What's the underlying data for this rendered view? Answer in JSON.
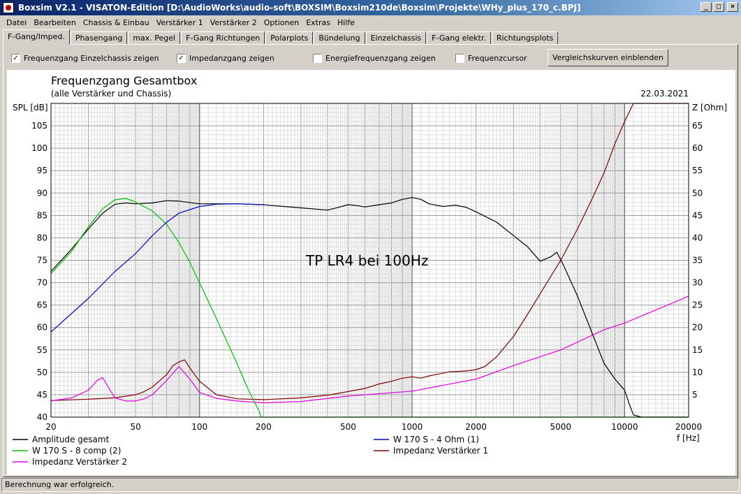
{
  "window": {
    "title": "Boxsim V2.1 - VISATON-Edition [D:\\AudioWorks\\audio-soft\\BOXSIM\\Boxsim210de\\Boxsim\\Projekte\\WHy_plus_170_c.BPJ]",
    "btn_min": "_",
    "btn_max": "□",
    "btn_close": "×"
  },
  "menu": [
    "Datei",
    "Bearbeiten",
    "Chassis & Einbau",
    "Verstärker 1",
    "Verstärker 2",
    "Optionen",
    "Extras",
    "Hilfe"
  ],
  "tabs": [
    "F-Gang/Imped.",
    "Phasengang",
    "max. Pegel",
    "F-Gang Richtungen",
    "Polarplots",
    "Bündelung",
    "Einzelchassis",
    "F-Gang elektr.",
    "Richtungsplots"
  ],
  "options": {
    "chk1": {
      "label": "Frequenzgang Einzelchassis zeigen",
      "mark": "✓"
    },
    "chk2": {
      "label": "Impedanzgang zeigen",
      "mark": "✓"
    },
    "chk3": {
      "label": "Energiefrequenzgang zeigen",
      "mark": ""
    },
    "chk4": {
      "label": "Frequenzcursor",
      "mark": ""
    },
    "compare_button": "Vergleichskurven einblenden"
  },
  "status": "Berechnung war erfolgreich.",
  "chart_data": {
    "type": "line",
    "title": "Frequenzgang Gesamtbox",
    "subtitle": "(alle Verstärker und Chassis)",
    "date": "22.03.2021",
    "annotation": "TP LR4 bei 100Hz",
    "xlabel": "f [Hz]",
    "ylabel": "SPL [dB]",
    "y2label": "Z [Ohm]",
    "xscale": "log",
    "xlim": [
      20,
      20000
    ],
    "ylim": [
      40,
      110
    ],
    "y2lim": [
      0,
      70
    ],
    "xticks": [
      20,
      50,
      100,
      200,
      500,
      1000,
      2000,
      5000,
      10000,
      20000
    ],
    "xtick_labels": [
      "20",
      "50",
      "100",
      "200",
      "500",
      "1000",
      "2000",
      "5000",
      "10000",
      "20000"
    ],
    "yticks": [
      40,
      45,
      50,
      55,
      60,
      65,
      70,
      75,
      80,
      85,
      90,
      95,
      100,
      105
    ],
    "y2ticks": [
      5,
      10,
      15,
      20,
      25,
      30,
      35,
      40,
      45,
      50,
      55,
      60,
      65
    ],
    "grid": true,
    "legend_position": "bottom",
    "series": [
      {
        "name": "Amplitude gesamt",
        "axis": "left",
        "color": "#000000",
        "x": [
          20,
          25,
          30,
          35,
          40,
          45,
          50,
          60,
          70,
          80,
          100,
          120,
          150,
          200,
          250,
          300,
          400,
          450,
          500,
          550,
          600,
          700,
          800,
          900,
          1000,
          1100,
          1200,
          1400,
          1600,
          1800,
          2000,
          2500,
          3000,
          3500,
          4000,
          4500,
          4800,
          5200,
          6000,
          7000,
          8000,
          9000,
          10000,
          10500,
          11000,
          12000,
          20000
        ],
        "y": [
          72.5,
          77.5,
          82,
          85.5,
          87.5,
          87.8,
          87.6,
          87.8,
          88.3,
          88.2,
          87.6,
          87.6,
          87.6,
          87.4,
          87,
          86.7,
          86.2,
          86.8,
          87.4,
          87.2,
          86.9,
          87.4,
          87.8,
          88.6,
          89,
          88.6,
          87.6,
          87,
          87.3,
          86.8,
          85.8,
          83.5,
          80.5,
          78,
          74.8,
          75.8,
          76.8,
          73.5,
          67,
          59,
          52,
          48.5,
          46,
          43,
          40.5,
          40,
          40
        ]
      },
      {
        "name": "W 170 S - 4 Ohm (1)",
        "axis": "left",
        "color": "#0000c0",
        "x": [
          20,
          30,
          40,
          50,
          60,
          70,
          80,
          100,
          120,
          150,
          200
        ],
        "y": [
          59,
          66.5,
          72.5,
          76.5,
          80.5,
          83.5,
          85.5,
          87,
          87.5,
          87.6,
          87.4
        ]
      },
      {
        "name": "W 170 S - 8 comp (2)",
        "axis": "left",
        "color": "#00c000",
        "x": [
          20,
          25,
          30,
          35,
          40,
          45,
          50,
          60,
          70,
          80,
          90,
          100,
          120,
          150,
          170,
          190,
          195,
          20000
        ],
        "y": [
          72,
          77,
          82.5,
          86.5,
          88.5,
          88.8,
          88,
          86,
          83,
          79,
          74.5,
          70,
          62,
          52,
          46,
          41.5,
          40,
          40
        ]
      },
      {
        "name": "Impedanz Verstärker 1",
        "axis": "right",
        "color": "#800000",
        "x": [
          20,
          30,
          40,
          50,
          55,
          60,
          70,
          75,
          80,
          85,
          90,
          100,
          120,
          150,
          200,
          300,
          400,
          500,
          600,
          700,
          800,
          900,
          1000,
          1100,
          1200,
          1500,
          1800,
          2000,
          2200,
          2500,
          3000,
          3500,
          4000,
          5000,
          6000,
          7000,
          8000,
          9000,
          10000,
          11000,
          11500,
          20000
        ],
        "y": [
          3.7,
          4,
          4.3,
          5,
          5.7,
          6.7,
          9.5,
          11.5,
          12.3,
          12.8,
          11,
          8,
          5,
          4.1,
          3.9,
          4.3,
          4.9,
          5.7,
          6.4,
          7.4,
          8,
          8.7,
          9,
          8.7,
          9.2,
          10.1,
          10.3,
          10.6,
          11.3,
          13.5,
          18,
          23,
          27.5,
          35,
          42,
          48.5,
          54.5,
          61,
          66,
          70,
          70,
          70
        ]
      },
      {
        "name": "Impedanz Verstärker 2",
        "axis": "right",
        "color": "#e000e0",
        "x": [
          20,
          25,
          30,
          33,
          35,
          38,
          40,
          45,
          50,
          55,
          60,
          70,
          80,
          90,
          100,
          120,
          150,
          200,
          300,
          500,
          1000,
          2000,
          3000,
          5000,
          8000,
          10000,
          15000,
          20000
        ],
        "y": [
          3.6,
          4.3,
          6,
          8.2,
          8.8,
          6,
          4.3,
          3.6,
          3.6,
          4.1,
          5,
          8.2,
          11.3,
          8.5,
          5.5,
          4.2,
          3.6,
          3.2,
          3.5,
          4.7,
          5.8,
          8.5,
          11.5,
          15,
          19.5,
          21,
          24.5,
          27
        ]
      }
    ]
  }
}
